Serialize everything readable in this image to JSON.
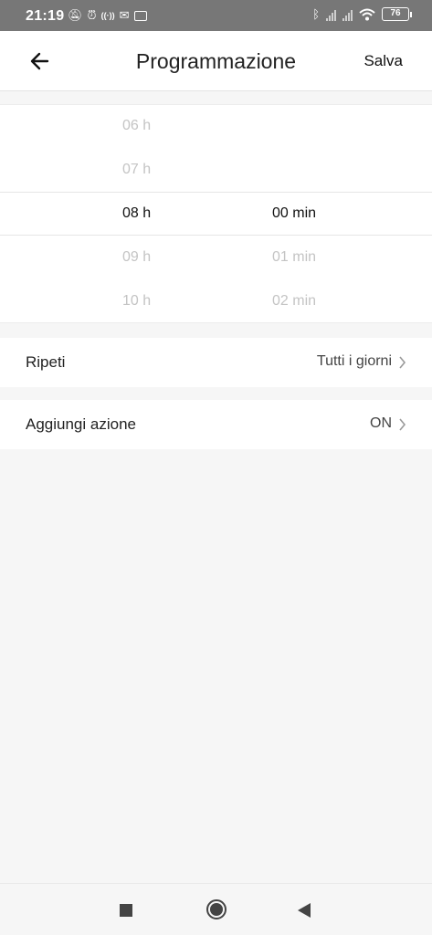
{
  "status_bar": {
    "time": "21:19",
    "icons_left": [
      "notifications-off-icon",
      "alarm-icon",
      "hotspot-icon",
      "mail-icon",
      "app-notification-icon"
    ],
    "icons_right": [
      "bluetooth-icon",
      "signal-icon",
      "signal-icon",
      "wifi-icon",
      "battery-icon"
    ],
    "battery_level": "76"
  },
  "header": {
    "title": "Programmazione",
    "save_label": "Salva",
    "back_icon": "back-arrow-icon"
  },
  "time_picker": {
    "hours": [
      "06 h",
      "07 h",
      "08 h",
      "09 h",
      "10 h"
    ],
    "minutes": [
      "",
      "",
      "00 min",
      "01 min",
      "02 min"
    ],
    "selected_hour": "08 h",
    "selected_minute": "00 min"
  },
  "settings": {
    "repeat": {
      "label": "Ripeti",
      "value": "Tutti i giorni"
    },
    "add_action": {
      "label": "Aggiungi azione",
      "value": "ON"
    }
  },
  "nav_bar": {
    "buttons": [
      "recents-icon",
      "home-icon",
      "back-icon"
    ]
  },
  "colors": {
    "status_bar": "#777777",
    "background": "#f6f6f6",
    "card": "#ffffff",
    "selected_text": "#111111",
    "faded_text": "#c4c4c4"
  }
}
